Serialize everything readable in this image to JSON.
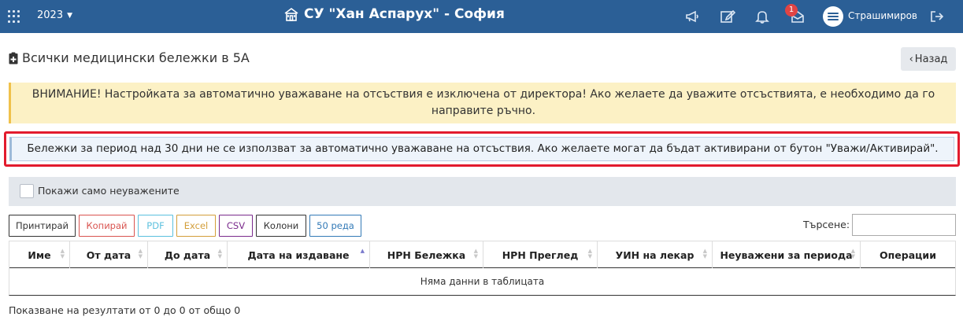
{
  "topbar": {
    "year": "2023",
    "school_name": "СУ \"Хан Аспарух\" - София",
    "notification_count": "1",
    "username": "Страшимиров",
    "icons": [
      "apps-grid-icon",
      "megaphone-icon",
      "edit-icon",
      "bell-icon",
      "mail-icon",
      "logout-icon"
    ]
  },
  "page": {
    "title": "Всички медицински бележки в 5А",
    "back_label": "Назад"
  },
  "alerts": {
    "warning": "ВНИМАНИЕ! Настройката за автоматично уважаване на отсъствия е изключена от директора! Ако желаете да уважите отсъствията, е необходимо да го направите ръчно.",
    "info": "Бележки за период над 30 дни не се използват за автоматично уважаване на отсъствия. Ако желаете могат да бъдат активирани от бутон \"Уважи/Активирай\"."
  },
  "filter": {
    "show_unexcused_label": "Покажи само неуважените",
    "checked": false
  },
  "toolbar": {
    "buttons": [
      {
        "label": "Принтирай",
        "color": "#333333"
      },
      {
        "label": "Копирай",
        "color": "#d9534f"
      },
      {
        "label": "PDF",
        "color": "#5bc0de"
      },
      {
        "label": "Excel",
        "color": "#d39e3a"
      },
      {
        "label": "CSV",
        "color": "#7a2a8c"
      },
      {
        "label": "Колони",
        "color": "#333333"
      },
      {
        "label": "50 реда",
        "color": "#337ab7"
      }
    ],
    "search_label": "Търсене:",
    "search_value": ""
  },
  "table": {
    "columns": [
      "Име",
      "От дата",
      "До дата",
      "Дата на издаване",
      "НРН Бележка",
      "НРН Преглед",
      "УИН на лекар",
      "Неуважени за периода",
      "Операции"
    ],
    "empty_message": "Няма данни в таблицата",
    "info": "Показване на резултати от 0 до 0 от общо 0"
  },
  "colors": {
    "topbar": "#2b5f96",
    "warning_bg": "#fcf1c5",
    "highlight_border": "#e21b2d",
    "info_bg": "#eef4fb"
  }
}
